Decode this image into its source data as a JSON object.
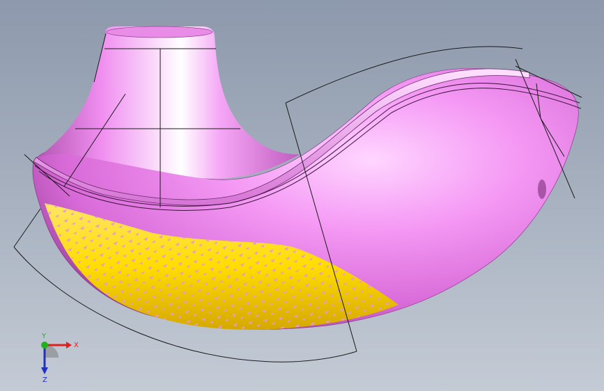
{
  "viewport": {
    "background_top": "#8d99ac",
    "background_bottom": "#c4cbd5",
    "model": {
      "name": "",
      "body_color": "#f08ff0",
      "highlight_color": "#ffd6ff",
      "shadow_color": "#9c3e9c",
      "textured_face_color": "#ffde00",
      "texture_dot_color": "#e69ad0",
      "wireframe_color": "#1a1a1a"
    },
    "triad": {
      "x_label": "X",
      "y_label": "Y",
      "z_label": "Z",
      "x_color": "#e02020",
      "y_color": "#20b020",
      "z_color": "#2030c0"
    }
  }
}
